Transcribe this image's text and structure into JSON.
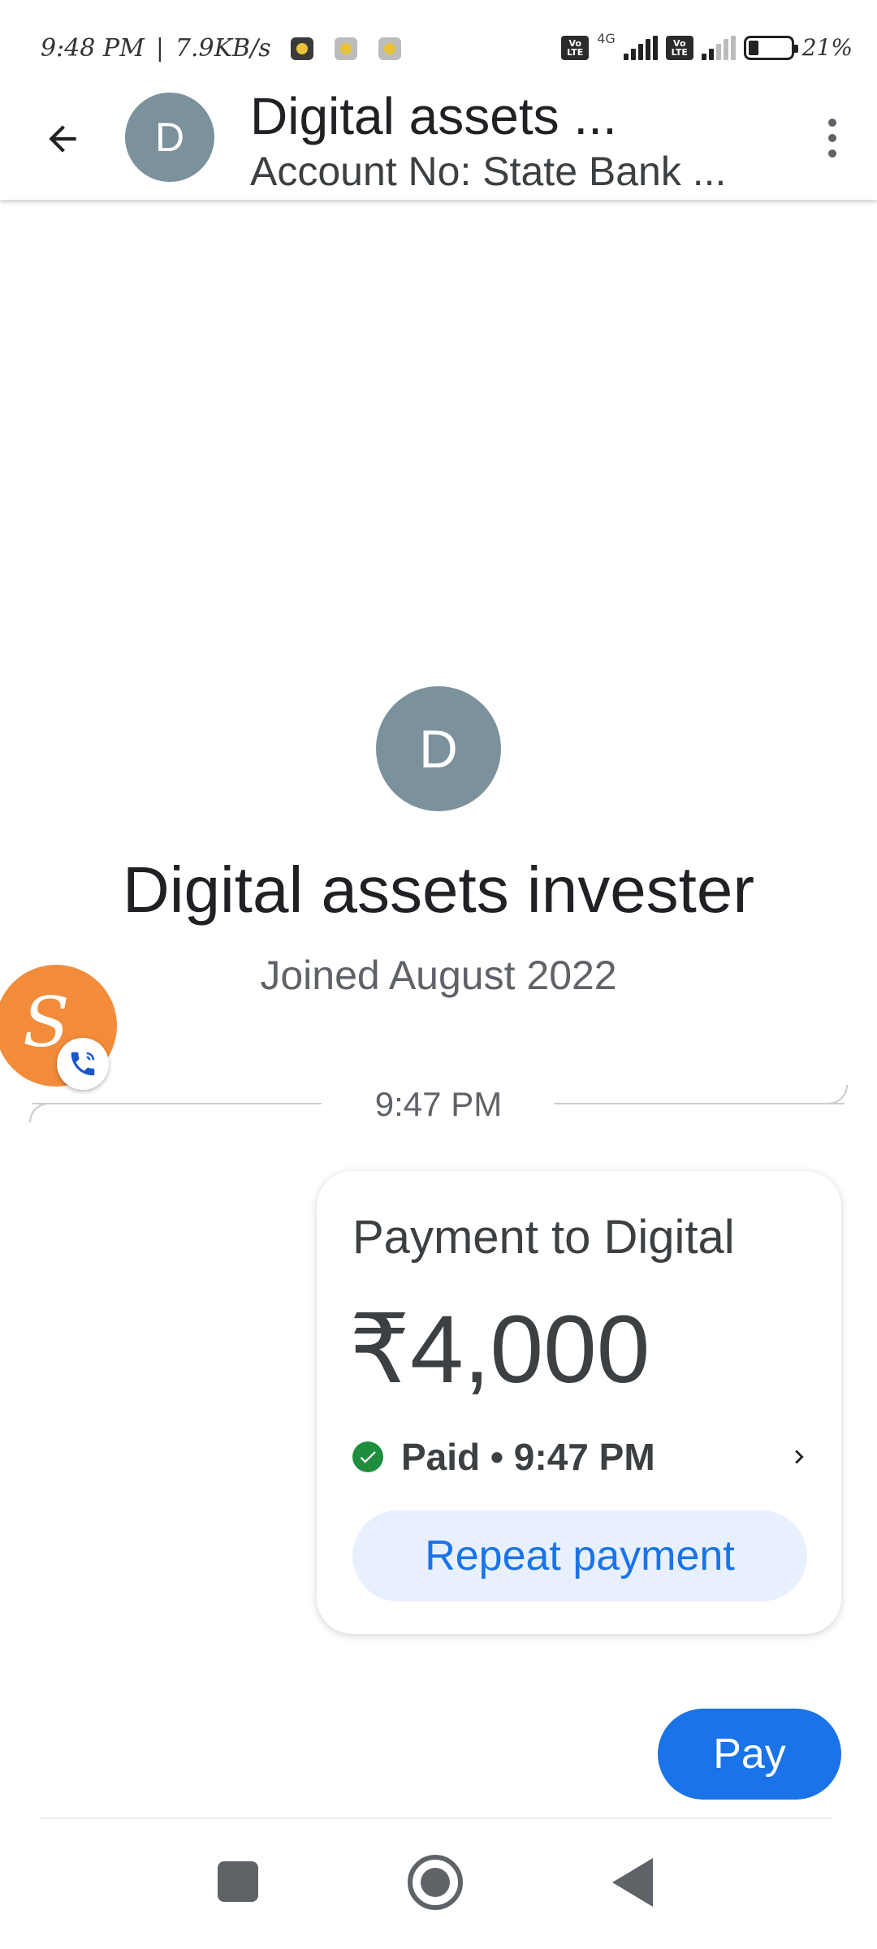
{
  "status_bar": {
    "time": "9:48 PM",
    "separator": "|",
    "speed": "7.9KB/s",
    "volte_label": "Vo LTE",
    "net_type": "4G",
    "battery": "21%",
    "icons": [
      "whatsapp-icon",
      "chat-app-icon",
      "media-app-icon",
      "volte-icon",
      "signal-icon",
      "battery-icon"
    ]
  },
  "header": {
    "avatar_letter": "D",
    "title": "Digital assets ...",
    "subtitle": "Account No: State Bank ..."
  },
  "contact": {
    "avatar_letter": "D",
    "name": "Digital assets invester",
    "joined": "Joined August 2022"
  },
  "chat_head": {
    "letter": "S"
  },
  "conversation": {
    "divider_time": "9:47 PM",
    "payment": {
      "title": "Payment to Digital",
      "amount": "₹4,000",
      "status": "Paid • 9:47 PM",
      "repeat_label": "Repeat payment"
    }
  },
  "footer": {
    "pay_label": "Pay"
  },
  "colors": {
    "accent_blue": "#1a73e8",
    "avatar_gray": "#7b919b",
    "success_green": "#1e8e3e",
    "chat_head_orange": "#f28c3a",
    "repeat_bg": "#e8f0fe"
  }
}
